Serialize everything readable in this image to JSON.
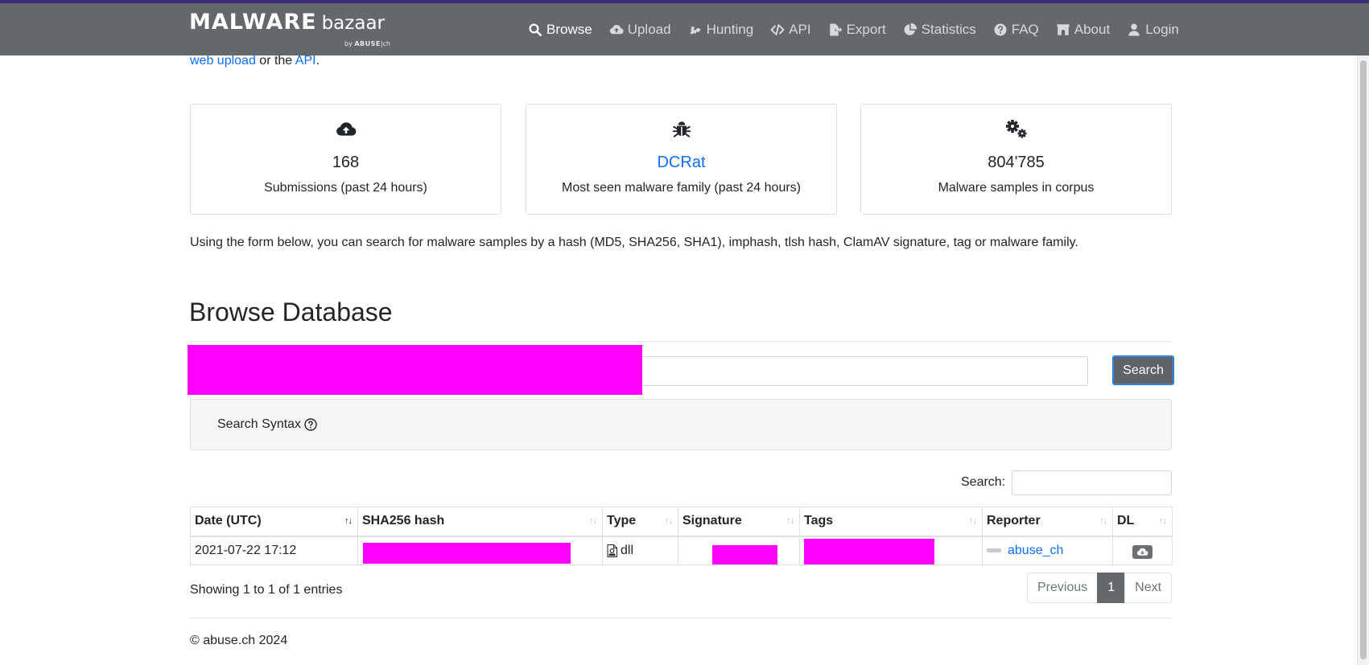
{
  "brand": {
    "name_bold": "MALWARE",
    "name_light": "bazaar",
    "by": "by",
    "org": "ABUSE",
    "org_suffix": "|ch"
  },
  "nav": {
    "items": [
      {
        "label": "Browse",
        "icon": "search-icon",
        "active": true
      },
      {
        "label": "Upload",
        "icon": "cloud-upload-icon"
      },
      {
        "label": "Hunting",
        "icon": "hunting-icon"
      },
      {
        "label": "API",
        "icon": "code-icon"
      },
      {
        "label": "Export",
        "icon": "file-export-icon"
      },
      {
        "label": "Statistics",
        "icon": "chart-pie-icon"
      },
      {
        "label": "FAQ",
        "icon": "question-circle-icon"
      },
      {
        "label": "About",
        "icon": "archway-icon"
      },
      {
        "label": "Login",
        "icon": "user-icon"
      }
    ]
  },
  "intro": {
    "link1": "web upload",
    "mid": " or the ",
    "link2": "API",
    "end": "."
  },
  "stats": {
    "cards": [
      {
        "icon": "cloud-upload-icon",
        "value": "168",
        "label": "Submissions (past 24 hours)"
      },
      {
        "icon": "bug-icon",
        "value": "DCRat",
        "label": "Most seen malware family (past 24 hours)",
        "link": true
      },
      {
        "icon": "cogs-icon",
        "value": "804'785",
        "label": "Malware samples in corpus"
      }
    ]
  },
  "description": "Using the form below, you can search for malware samples by a hash (MD5, SHA256, SHA1), imphash, tlsh hash, ClamAV signature, tag or malware family.",
  "browse": {
    "title": "Browse Database",
    "search_value": "",
    "search_button": "Search",
    "syntax_label": "Search Syntax"
  },
  "table": {
    "search_label": "Search:",
    "columns": [
      "Date (UTC)",
      "SHA256 hash",
      "Type",
      "Signature",
      "Tags",
      "Reporter",
      "DL"
    ],
    "rows": [
      {
        "date": "2021-07-22 17:12",
        "type": "dll",
        "reporter": "abuse_ch"
      }
    ],
    "showing": "Showing 1 to 1 of 1 entries",
    "pagination": {
      "previous": "Previous",
      "page": "1",
      "next": "Next"
    }
  },
  "footer": "© abuse.ch 2024",
  "colors": {
    "navbar": "#65686b",
    "top_stripe": "#3b2c78",
    "link": "#0d6efd",
    "redaction": "#ff00ff"
  }
}
